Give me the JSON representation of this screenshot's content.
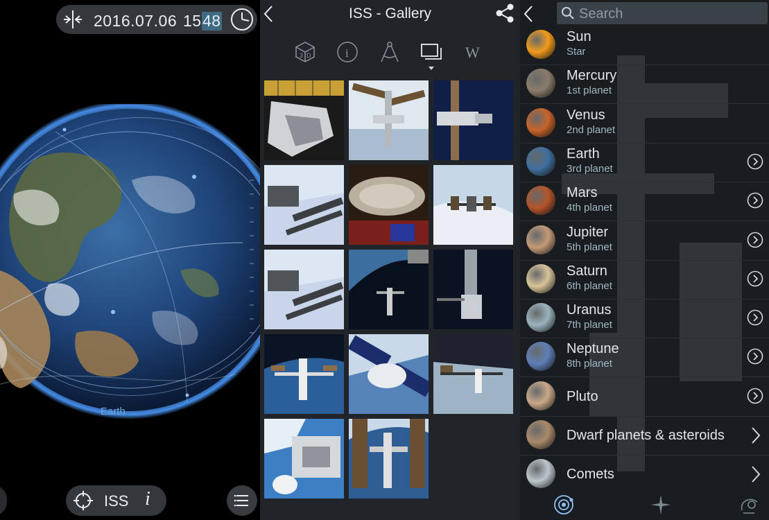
{
  "left_panel": {
    "date": "2016.07.06",
    "time_hours": "15:",
    "time_minutes": "48",
    "earth_label": "Earth",
    "selected_object": "ISS",
    "info_glyph": "i"
  },
  "gallery": {
    "title": "ISS - Gallery",
    "tabs": [
      "3d-view-icon",
      "info-icon",
      "compass-icon",
      "gallery-icon",
      "wikipedia-icon"
    ],
    "wiki_tab_label": "W",
    "selected_tab": "gallery-icon",
    "thumbnail_count": 14
  },
  "object_list": {
    "search_placeholder": "Search",
    "items": [
      {
        "name": "Sun",
        "type": "Star",
        "has_info_button": false,
        "color": "#f29b1b"
      },
      {
        "name": "Mercury",
        "type": "1st planet",
        "has_info_button": false,
        "color": "#8b7d6b"
      },
      {
        "name": "Venus",
        "type": "2nd planet",
        "has_info_button": false,
        "color": "#c8642a"
      },
      {
        "name": "Earth",
        "type": "3rd planet",
        "has_info_button": true,
        "color": "#3f6f9e"
      },
      {
        "name": "Mars",
        "type": "4th planet",
        "has_info_button": true,
        "color": "#b5542a"
      },
      {
        "name": "Jupiter",
        "type": "5th planet",
        "has_info_button": true,
        "color": "#c49a77"
      },
      {
        "name": "Saturn",
        "type": "6th planet",
        "has_info_button": true,
        "color": "#d8c49a"
      },
      {
        "name": "Uranus",
        "type": "7th planet",
        "has_info_button": true,
        "color": "#9bb3bd"
      },
      {
        "name": "Neptune",
        "type": "8th planet",
        "has_info_button": true,
        "color": "#5f7fb8"
      },
      {
        "name": "Pluto",
        "type": "",
        "has_info_button": true,
        "color": "#c9a98a"
      },
      {
        "name": "Dwarf planets & asteroids",
        "type": "",
        "has_info_button": false,
        "color": "#a98a6a"
      },
      {
        "name": "Comets",
        "type": "",
        "has_info_button": false,
        "color": "#bcc6cc"
      }
    ],
    "bottom_tabs": [
      "solar-system-icon",
      "stars-icon",
      "satellite-icon"
    ]
  },
  "colors": {
    "accent_blue": "#6aa8dc",
    "panel_dark": "#212428",
    "list_dark": "#1a1d20",
    "pill_gray": "#464a50"
  }
}
